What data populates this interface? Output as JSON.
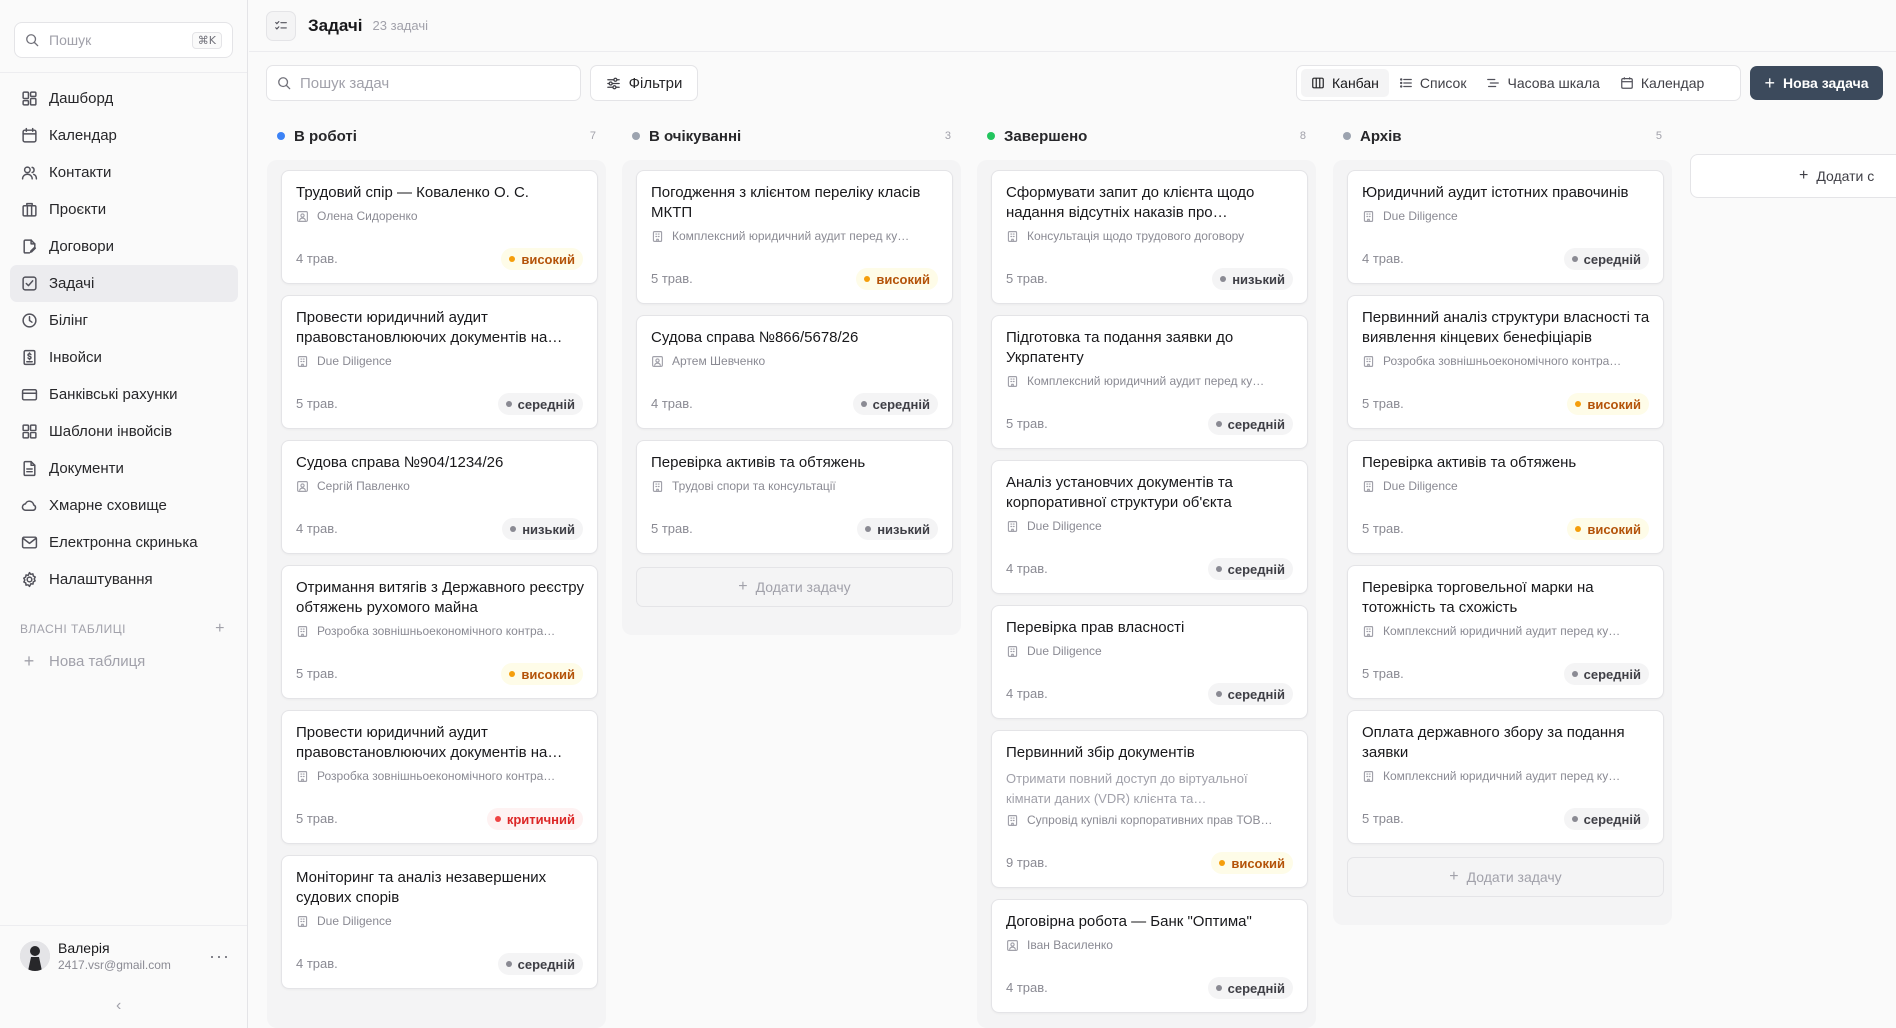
{
  "sidebar": {
    "search_placeholder": "Пошук",
    "search_shortcut": "⌘K",
    "nav": [
      {
        "label": "Дашборд",
        "icon": "dashboard-icon"
      },
      {
        "label": "Календар",
        "icon": "calendar-icon"
      },
      {
        "label": "Контакти",
        "icon": "contacts-icon"
      },
      {
        "label": "Проєкти",
        "icon": "projects-icon"
      },
      {
        "label": "Договори",
        "icon": "contracts-icon"
      },
      {
        "label": "Задачі",
        "icon": "tasks-icon",
        "active": true
      },
      {
        "label": "Білінг",
        "icon": "billing-icon"
      },
      {
        "label": "Інвойси",
        "icon": "invoices-icon"
      },
      {
        "label": "Банківські рахунки",
        "icon": "bank-accounts-icon"
      },
      {
        "label": "Шаблони інвойсів",
        "icon": "invoice-templates-icon"
      },
      {
        "label": "Документи",
        "icon": "documents-icon"
      },
      {
        "label": "Хмарне сховище",
        "icon": "cloud-storage-icon"
      },
      {
        "label": "Електронна скринька",
        "icon": "mailbox-icon"
      },
      {
        "label": "Налаштування",
        "icon": "settings-icon"
      }
    ],
    "own_tables_label": "ВЛАСНІ ТАБЛИЦІ",
    "new_table_label": "Нова таблиця",
    "user": {
      "name": "Валерія",
      "email": "2417.vsr@gmail.com"
    }
  },
  "header": {
    "title": "Задачі",
    "count": "23 задачі"
  },
  "toolbar": {
    "search_placeholder": "Пошук задач",
    "filters_label": "Фільтри",
    "views": [
      "Канбан",
      "Список",
      "Часова шкала",
      "Календар"
    ],
    "active_view": "Канбан",
    "new_task_label": "Нова задача"
  },
  "add_task_label": "Додати задачу",
  "add_column_label": "Додати с",
  "colors": {
    "accent": "#3c4a5c",
    "in_progress": "#3b82f6",
    "waiting": "#9ca3af",
    "done": "#22c55e",
    "archive": "#9ca3af",
    "high": "#f59e0b",
    "critical": "#ef4444"
  },
  "columns": [
    {
      "title": "В роботі",
      "count": "7",
      "dot": "#3b82f6",
      "cards": [
        {
          "title": "Трудовий спір — Коваленко О. С.",
          "meta": "Олена Сидоренко",
          "meta_icon": "person-icon",
          "date": "4 трав.",
          "priority": "високий",
          "level": "high"
        },
        {
          "title": "Провести юридичний аудит правовстановлюючих документів на…",
          "meta": "Due Diligence",
          "meta_icon": "building-icon",
          "date": "5 трав.",
          "priority": "середній",
          "level": "medium"
        },
        {
          "title": "Судова справа №904/1234/26",
          "meta": "Сергій Павленко",
          "meta_icon": "person-icon",
          "date": "4 трав.",
          "priority": "низький",
          "level": "low"
        },
        {
          "title": "Отримання витягів з Державного реєстру обтяжень рухомого майна",
          "meta": "Розробка зовнішньоекономічного контра…",
          "meta_icon": "building-icon",
          "date": "5 трав.",
          "priority": "високий",
          "level": "high"
        },
        {
          "title": "Провести юридичний аудит правовстановлюючих документів на…",
          "meta": "Розробка зовнішньоекономічного контра…",
          "meta_icon": "building-icon",
          "date": "5 трав.",
          "priority": "критичний",
          "level": "crit"
        },
        {
          "title": "Моніторинг та аналіз незавершених судових спорів",
          "meta": "Due Diligence",
          "meta_icon": "building-icon",
          "date": "4 трав.",
          "priority": "середній",
          "level": "medium"
        }
      ]
    },
    {
      "title": "В очікуванні",
      "count": "3",
      "dot": "#9ca3af",
      "cards": [
        {
          "title": "Погодження з клієнтом переліку класів МКТП",
          "meta": "Комплексний юридичний аудит перед ку…",
          "meta_icon": "building-icon",
          "date": "5 трав.",
          "priority": "високий",
          "level": "high"
        },
        {
          "title": "Судова справа №866/5678/26",
          "meta": "Артем Шевченко",
          "meta_icon": "person-icon",
          "date": "4 трав.",
          "priority": "середній",
          "level": "medium"
        },
        {
          "title": "Перевірка активів та обтяжень",
          "meta": "Трудові спори та консультації",
          "meta_icon": "building-icon",
          "date": "5 трав.",
          "priority": "низький",
          "level": "low"
        }
      ]
    },
    {
      "title": "Завершено",
      "count": "8",
      "dot": "#22c55e",
      "cards": [
        {
          "title": "Сформувати запит до клієнта щодо надання відсутніх наказів про…",
          "meta": "Консультація щодо трудового договору",
          "meta_icon": "building-icon",
          "date": "5 трав.",
          "priority": "низький",
          "level": "low"
        },
        {
          "title": "Підготовка та подання заявки до Укрпатенту",
          "meta": "Комплексний юридичний аудит перед ку…",
          "meta_icon": "building-icon",
          "date": "5 трав.",
          "priority": "середній",
          "level": "medium"
        },
        {
          "title": "Аналіз установчих документів та корпоративної структури об'єкта",
          "meta": "Due Diligence",
          "meta_icon": "building-icon",
          "date": "4 трав.",
          "priority": "середній",
          "level": "medium"
        },
        {
          "title": "Перевірка прав власності",
          "meta": "Due Diligence",
          "meta_icon": "building-icon",
          "date": "4 трав.",
          "priority": "середній",
          "level": "medium"
        },
        {
          "title": "Первинний збір документів",
          "desc": "Отримати повний доступ до віртуальної кімнати даних (VDR) клієнта та…",
          "meta": "Супровід купівлі корпоративних прав ТОВ…",
          "meta_icon": "building-icon",
          "date": "9 трав.",
          "priority": "високий",
          "level": "high"
        },
        {
          "title": "Договірна робота — Банк \"Оптима\"",
          "meta": "Іван Василенко",
          "meta_icon": "person-icon",
          "date": "4 трав.",
          "priority": "середній",
          "level": "medium"
        }
      ]
    },
    {
      "title": "Архів",
      "count": "5",
      "dot": "#9ca3af",
      "cards": [
        {
          "title": "Юридичний аудит істотних правочинів",
          "meta": "Due Diligence",
          "meta_icon": "building-icon",
          "date": "4 трав.",
          "priority": "середній",
          "level": "medium"
        },
        {
          "title": "Первинний аналіз структури власності та виявлення кінцевих бенефіціарів",
          "meta": "Розробка зовнішньоекономічного контра…",
          "meta_icon": "building-icon",
          "date": "5 трав.",
          "priority": "високий",
          "level": "high"
        },
        {
          "title": "Перевірка активів та обтяжень",
          "meta": "Due Diligence",
          "meta_icon": "building-icon",
          "date": "5 трав.",
          "priority": "високий",
          "level": "high"
        },
        {
          "title": "Перевірка торговельної марки на тотожність та схожість",
          "meta": "Комплексний юридичний аудит перед ку…",
          "meta_icon": "building-icon",
          "date": "5 трав.",
          "priority": "середній",
          "level": "medium"
        },
        {
          "title": "Оплата державного збору за подання заявки",
          "meta": "Комплексний юридичний аудит перед ку…",
          "meta_icon": "building-icon",
          "date": "5 трав.",
          "priority": "середній",
          "level": "medium"
        }
      ]
    }
  ]
}
